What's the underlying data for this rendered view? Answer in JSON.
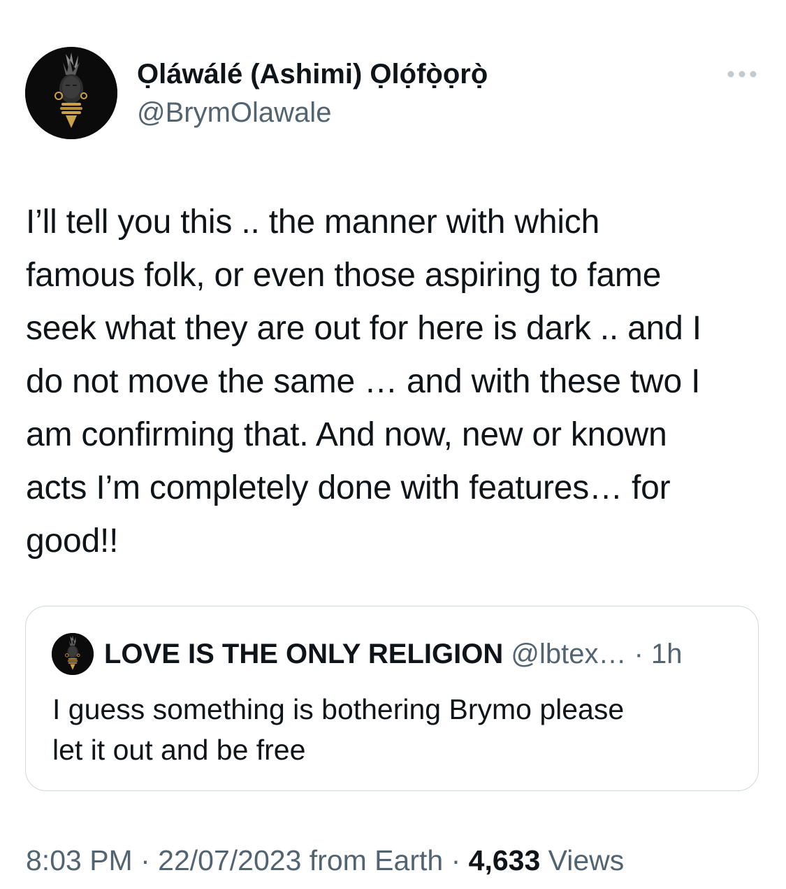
{
  "author": {
    "display_name": "Ọláwálé (Ashimi) Ọlọ́fọ̀ọrọ̀",
    "handle": "@BrymOlawale",
    "avatar_icon": "tribal-portrait-avatar"
  },
  "tweet": {
    "text_lines": [
      "I’ll tell you this .. the manner with which",
      "famous folk, or even those aspiring to fame",
      "seek what they are out for here is dark .. and I",
      "do not move the same … and with these two I",
      "am confirming that. And now, new or known",
      "acts I’m completely done with features… for",
      "good!!"
    ]
  },
  "quote": {
    "display_name": "LOVE IS THE ONLY RELIGION",
    "handle": "@lbtex…",
    "separator": "·",
    "time": "1h",
    "text_lines": [
      "I guess something is bothering Brymo please",
      "let it out and be free"
    ],
    "avatar_icon": "tribal-portrait-avatar"
  },
  "meta": {
    "time": "8:03 PM",
    "sep1": "·",
    "date": "22/07/2023",
    "source": "from Earth",
    "sep2": "·",
    "views_count": "4,633",
    "views_label": "Views"
  },
  "icons": {
    "more": "more-horizontal-icon"
  },
  "colors": {
    "primary_text": "#0f1419",
    "secondary_text": "#536471",
    "border": "#cfd9de",
    "background": "#ffffff"
  }
}
